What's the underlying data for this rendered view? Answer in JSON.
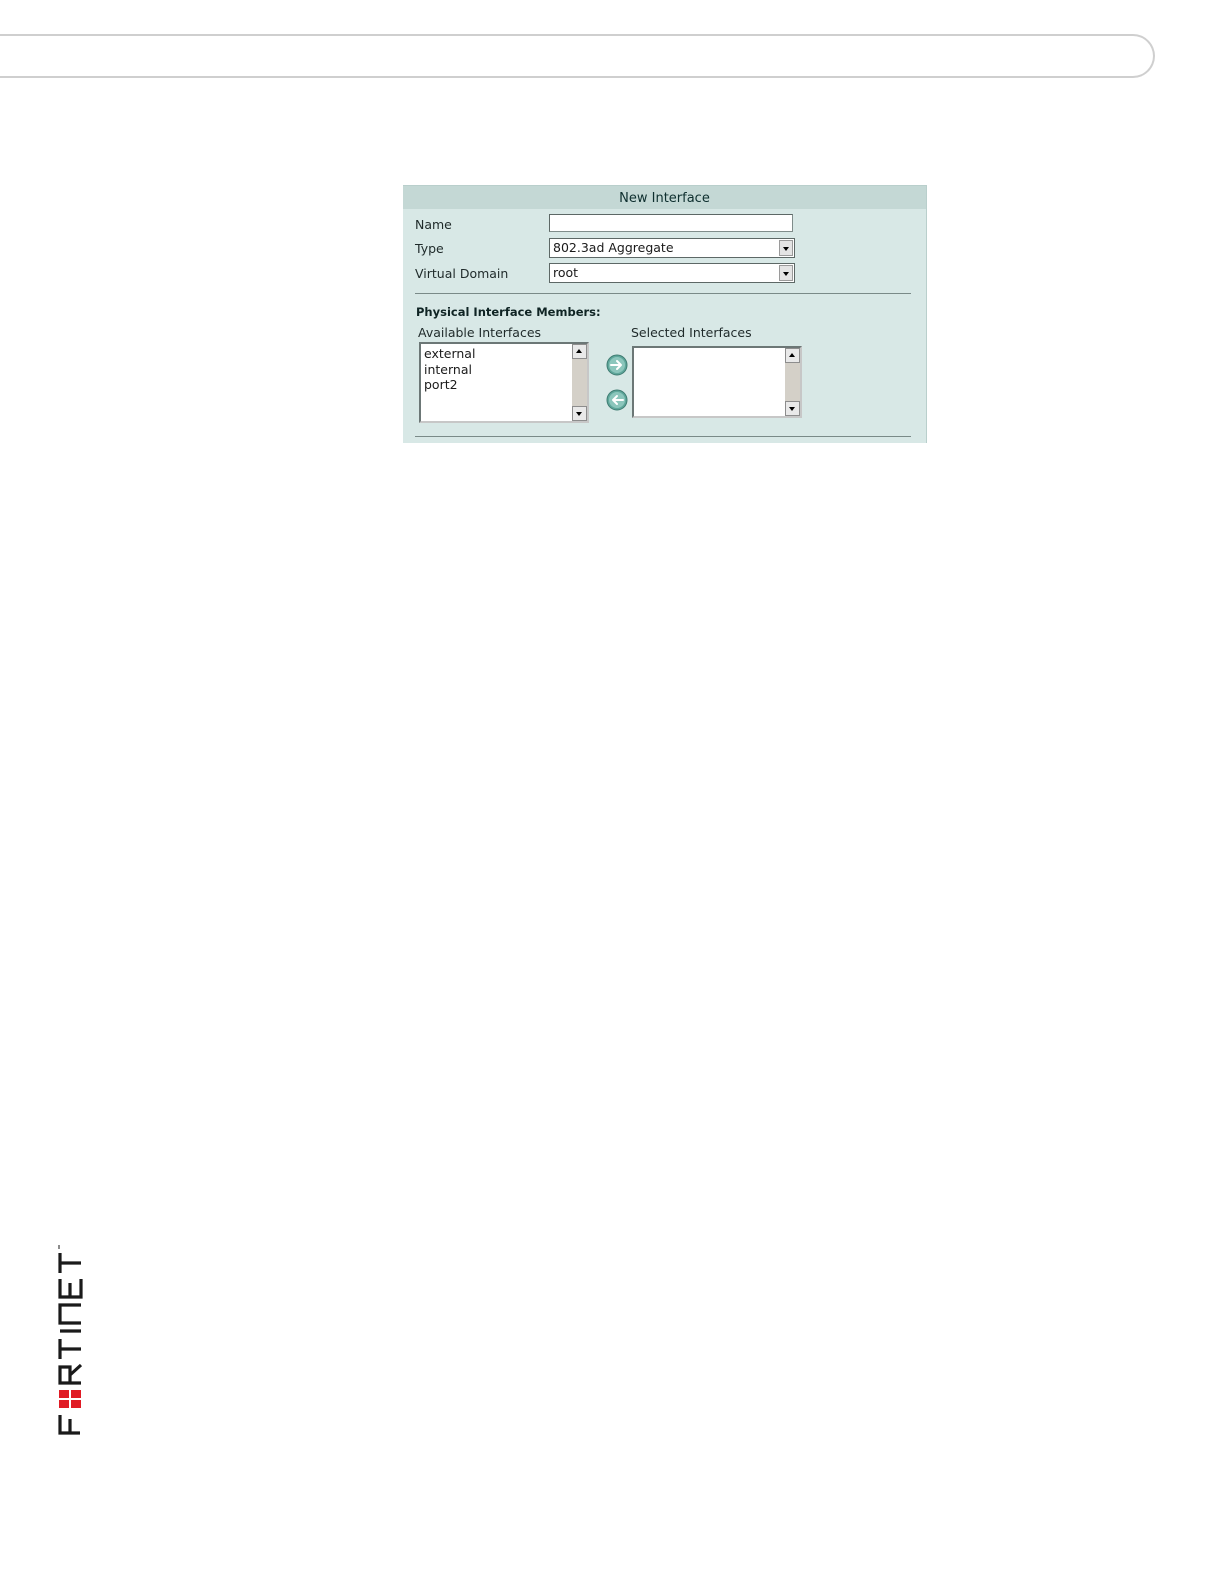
{
  "dialog": {
    "title": "New Interface",
    "fields": {
      "name": {
        "label": "Name",
        "value": "",
        "placeholder": ""
      },
      "type": {
        "label": "Type",
        "value": "802.3ad Aggregate"
      },
      "virtual_domain": {
        "label": "Virtual Domain",
        "value": "root"
      }
    },
    "members": {
      "section_title": "Physical Interface Members:",
      "available": {
        "label": "Available Interfaces",
        "items": [
          "external",
          "internal",
          "port2"
        ]
      },
      "selected": {
        "label": "Selected Interfaces",
        "items": []
      },
      "add_button_icon": "arrow-right-circle-icon",
      "remove_button_icon": "arrow-left-circle-icon"
    }
  },
  "branding": {
    "logo_text": "FORTINET",
    "logo_accent_color": "#e01b24"
  },
  "colors": {
    "dialog_background": "#d8e8e6",
    "dialog_title_background": "#c4d8d5",
    "move_button_color": "#5fa79b"
  }
}
